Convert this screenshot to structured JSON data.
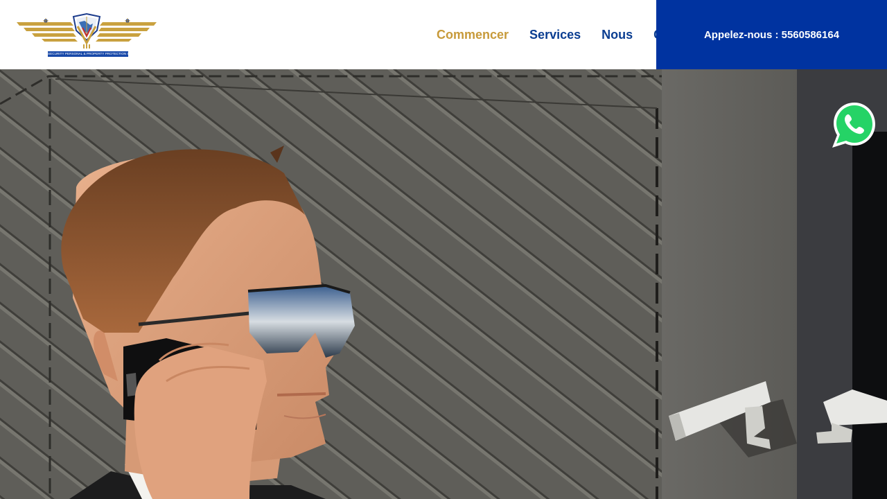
{
  "header": {
    "logo": {
      "icon": "winged-shield-logo",
      "caption": "SECURITY PERSONAL & PROPERTY PROTECTION CO."
    },
    "nav": [
      {
        "label": "Commencer",
        "active": true
      },
      {
        "label": "Services",
        "active": false
      },
      {
        "label": "Nous",
        "active": false
      },
      {
        "label": "Contact",
        "active": false
      }
    ],
    "call_label": "Appelez-nous : 5560586164"
  },
  "hero": {
    "image": "security-agent-on-phone-with-cctv-cameras"
  },
  "whatsapp": {
    "icon": "whatsapp-icon"
  },
  "colors": {
    "accent_gold": "#c79a3a",
    "nav_blue": "#0a3d91",
    "call_box_blue": "#0033a0",
    "whatsapp_green": "#25d366"
  }
}
